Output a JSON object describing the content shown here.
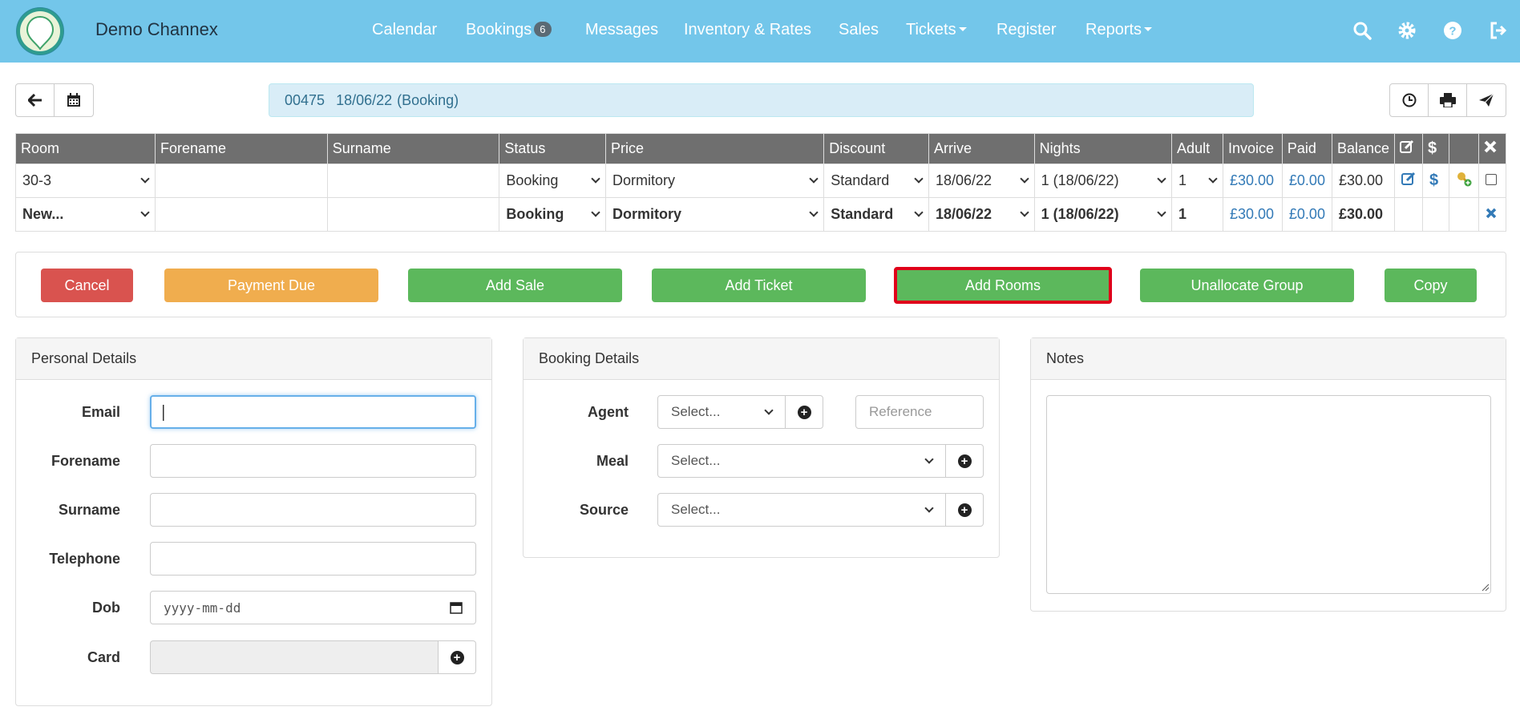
{
  "navbar": {
    "brand": "Demo Channex",
    "items": [
      {
        "label": "Calendar"
      },
      {
        "label": "Bookings",
        "badge": "6"
      },
      {
        "label": "Messages"
      },
      {
        "label": "Inventory & Rates"
      },
      {
        "label": "Sales"
      },
      {
        "label": "Tickets"
      },
      {
        "label": "Register"
      },
      {
        "label": "Reports"
      }
    ],
    "icons": [
      "search-icon",
      "gear-icon",
      "help-icon",
      "logout-icon"
    ]
  },
  "booking_ref": {
    "number": "00475",
    "date": "18/06/22",
    "type": "(Booking)"
  },
  "table": {
    "headers": [
      "Room",
      "Forename",
      "Surname",
      "Status",
      "Price",
      "Discount",
      "Arrive",
      "Nights",
      "Adult",
      "Invoice",
      "Paid",
      "Balance"
    ],
    "rows": [
      {
        "room": "30-3",
        "forename": "",
        "surname": "",
        "status": "Booking",
        "price": "Dormitory",
        "discount": "Standard",
        "arrive": "18/06/22",
        "nights": "1 (18/06/22)",
        "adult": "1",
        "invoice": "£30.00",
        "paid": "£0.00",
        "balance": "£30.00"
      },
      {
        "room": "New...",
        "forename": "",
        "surname": "",
        "status": "Booking",
        "price": "Dormitory",
        "discount": "Standard",
        "arrive": "18/06/22",
        "nights": "1 (18/06/22)",
        "adult": "1",
        "invoice": "£30.00",
        "paid": "£0.00",
        "balance": "£30.00"
      }
    ],
    "header_icons": [
      "edit-icon",
      "dollar-icon",
      "close-icon"
    ]
  },
  "actions": {
    "cancel": "Cancel",
    "payment_due": "Payment Due",
    "add_sale": "Add Sale",
    "add_ticket": "Add Ticket",
    "add_rooms": "Add Rooms",
    "unallocate_group": "Unallocate Group",
    "copy": "Copy"
  },
  "colors": {
    "navbar": "#73c6ea",
    "danger": "#d9534f",
    "warning": "#f0ad4e",
    "success": "#5cb85c",
    "highlight": "#e0001a"
  },
  "personal": {
    "title": "Personal Details",
    "email_label": "Email",
    "email_value": "",
    "forename_label": "Forename",
    "forename_value": "",
    "surname_label": "Surname",
    "surname_value": "",
    "telephone_label": "Telephone",
    "telephone_value": "",
    "dob_label": "Dob",
    "dob_placeholder": "yyyy-mm-dd",
    "card_label": "Card",
    "card_value": ""
  },
  "booking": {
    "title": "Booking Details",
    "agent_label": "Agent",
    "agent_value": "Select...",
    "reference_placeholder": "Reference",
    "meal_label": "Meal",
    "meal_value": "Select...",
    "source_label": "Source",
    "source_value": "Select..."
  },
  "notes": {
    "title": "Notes",
    "value": ""
  }
}
